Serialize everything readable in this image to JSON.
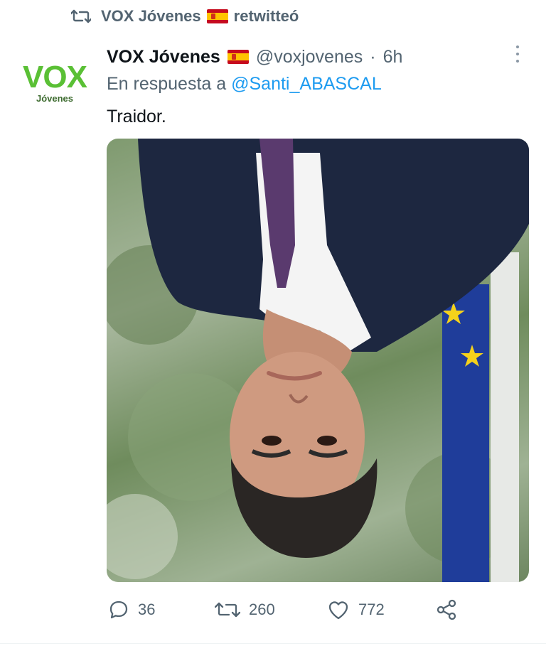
{
  "retweet_bar": {
    "retweeter_name": "VOX Jóvenes",
    "retweet_label": "retwitteó",
    "icon": "retweet-icon"
  },
  "avatar": {
    "logo_text": "VOX",
    "logo_sub": "Jóvenes"
  },
  "tweet": {
    "author_name": "VOX Jóvenes",
    "flag": "spain-flag-icon",
    "handle": "@voxjovenes",
    "separator": "·",
    "time": "6h",
    "reply_prefix": "En respuesta a",
    "reply_mention": "@Santi_ABASCAL",
    "text": "Traidor.",
    "media_description_icon": "photo-icon"
  },
  "actions": {
    "replies": "36",
    "retweets": "260",
    "likes": "772"
  },
  "colors": {
    "accent": "#1d9bf0",
    "secondary_text": "#536471",
    "vox_green": "#5ac035"
  }
}
